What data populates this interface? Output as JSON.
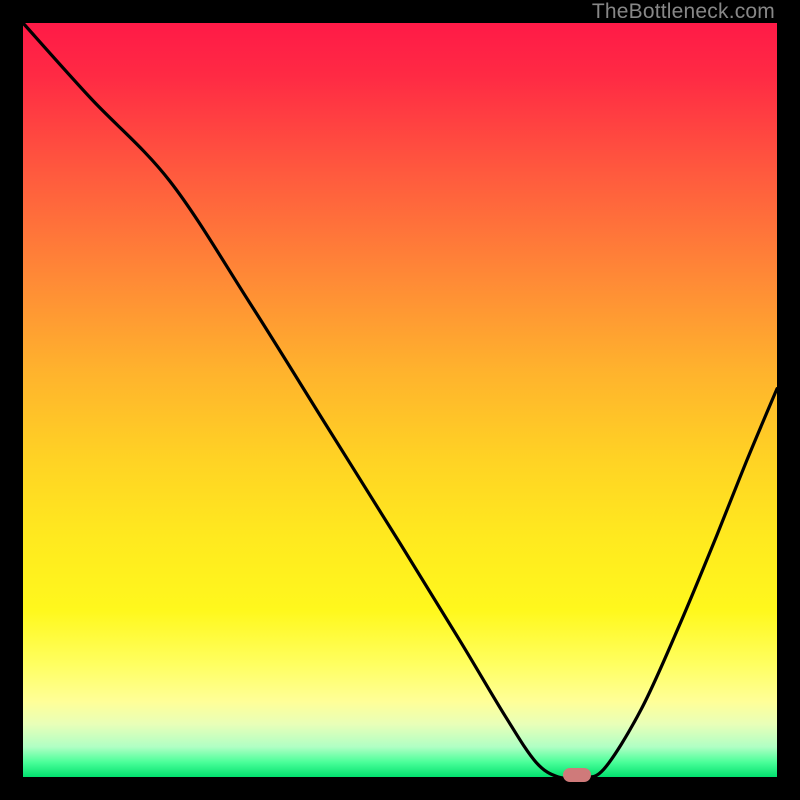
{
  "watermark": "TheBottleneck.com",
  "colors": {
    "page_bg": "#000000",
    "marker": "#cf7a7a",
    "curve": "#000000",
    "watermark_text": "#878787"
  },
  "chart_data": {
    "type": "line",
    "title": "",
    "xlabel": "",
    "ylabel": "",
    "xlim": [
      0,
      1
    ],
    "ylim": [
      0,
      1
    ],
    "grid": false,
    "legend": false,
    "note": "Axes have no tick labels; x is a normalized configuration parameter (0–1) and y is bottleneck severity (0 = none, 1 = max). Background gradient encodes severity: green low → red high.",
    "series": [
      {
        "name": "bottleneck-curve",
        "x": [
          0.0,
          0.09,
          0.195,
          0.3,
          0.4,
          0.5,
          0.58,
          0.64,
          0.68,
          0.71,
          0.74,
          0.77,
          0.82,
          0.87,
          0.92,
          0.96,
          1.0
        ],
        "y": [
          1.0,
          0.9,
          0.79,
          0.63,
          0.47,
          0.31,
          0.18,
          0.08,
          0.02,
          0.0,
          0.0,
          0.01,
          0.09,
          0.2,
          0.32,
          0.42,
          0.515
        ]
      }
    ],
    "flat_region_x": [
      0.69,
      0.76
    ],
    "marker": {
      "x": 0.735,
      "y": 0.003
    }
  }
}
